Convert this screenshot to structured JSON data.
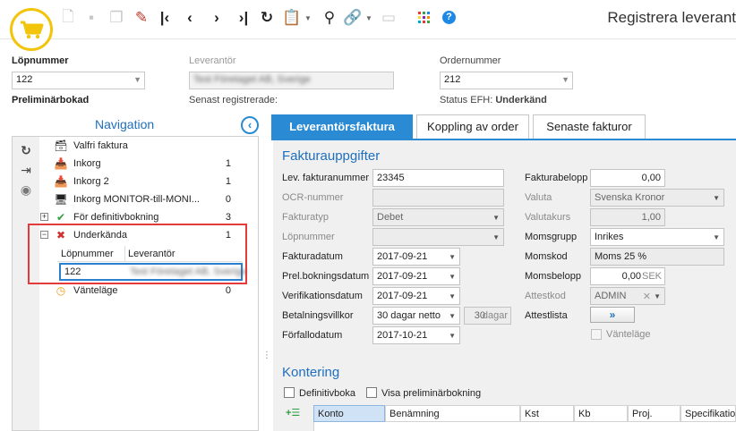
{
  "window": {
    "title": "Registrera leverant"
  },
  "toolbar": {
    "icons": [
      "cart-icon",
      "new-document-icon",
      "save-icon",
      "copy-icon",
      "delete-icon",
      "first-icon",
      "previous-icon",
      "next-icon",
      "last-icon",
      "refresh-icon",
      "clipboard-icon",
      "search-icon",
      "link-icon",
      "form-icon",
      "apps-grid-icon",
      "help-icon"
    ]
  },
  "header": {
    "lopnummer_label": "Löpnummer",
    "lopnummer_value": "122",
    "status_left": "Preliminärbokad",
    "leverantor_label": "Leverantör",
    "leverantor_value": "Test Företaget AB, Sverige",
    "senast_label": "Senast registrerade:",
    "ordernummer_label": "Ordernummer",
    "ordernummer_value": "212",
    "status_efh_label": "Status EFH:",
    "status_efh_value": "Underkänd"
  },
  "navigation": {
    "title": "Navigation",
    "items": [
      {
        "label": "Valfri faktura",
        "count": "",
        "icon": "inbox-icon"
      },
      {
        "label": "Inkorg",
        "count": "1",
        "icon": "inbox-icon"
      },
      {
        "label": "Inkorg 2",
        "count": "1",
        "icon": "inbox-icon"
      },
      {
        "label": "Inkorg MONITOR-till-MONI...",
        "count": "0",
        "icon": "monitor-inbox-icon"
      },
      {
        "label": "För definitivbokning",
        "count": "3",
        "icon": "checkmark-icon"
      },
      {
        "label": "Underkända",
        "count": "1",
        "icon": "cross-icon"
      },
      {
        "label": "Vänteläge",
        "count": "0",
        "icon": "clock-icon"
      }
    ],
    "sub_table": {
      "col1": "Löpnummer",
      "col2": "Leverantör",
      "row_lopnummer": "122",
      "row_leverantor": "Test Företaget AB, Sverige"
    }
  },
  "tabs": [
    "Leverantörsfaktura",
    "Koppling av order",
    "Senaste fakturor"
  ],
  "faktura": {
    "section_title": "Fakturauppgifter",
    "lev_fakturanummer_label": "Lev. fakturanummer",
    "lev_fakturanummer_value": "23345",
    "ocr_label": "OCR-nummer",
    "ocr_value": "",
    "fakturatyp_label": "Fakturatyp",
    "fakturatyp_value": "Debet",
    "lopnummer_label": "Löpnummer",
    "lopnummer_value": "",
    "fakturadatum_label": "Fakturadatum",
    "fakturadatum_value": "2017-09-21",
    "prel_label": "Prel.bokningsdatum",
    "prel_value": "2017-09-21",
    "verif_label": "Verifikationsdatum",
    "verif_value": "2017-09-21",
    "betalningsvillkor_label": "Betalningsvillkor",
    "betalningsvillkor_value": "30 dagar netto",
    "betalningsvillkor_days": "30",
    "betalningsvillkor_unit": "dagar",
    "forfallodatum_label": "Förfallodatum",
    "forfallodatum_value": "2017-10-21",
    "fakturabelopp_label": "Fakturabelopp",
    "fakturabelopp_value": "0,00",
    "valuta_label": "Valuta",
    "valuta_value": "Svenska Kronor",
    "valutakurs_label": "Valutakurs",
    "valutakurs_value": "1,00",
    "momsgrupp_label": "Momsgrupp",
    "momsgrupp_value": "Inrikes",
    "momskod_label": "Momskod",
    "momskod_value": "Moms 25 %",
    "momsbelopp_label": "Momsbelopp",
    "momsbelopp_value": "0,00",
    "momsbelopp_unit": "SEK",
    "attestkod_label": "Attestkod",
    "attestkod_value": "ADMIN",
    "attestlista_label": "Attestlista",
    "vantelage_label": "Vänteläge"
  },
  "kontering": {
    "title": "Kontering",
    "definitivbokning_label": "Definitivboka",
    "visa_prel_label": "Visa preliminärbokning",
    "columns": [
      "Konto",
      "Benämning",
      "Kst",
      "Kb",
      "Proj.",
      "Specifikation"
    ]
  }
}
